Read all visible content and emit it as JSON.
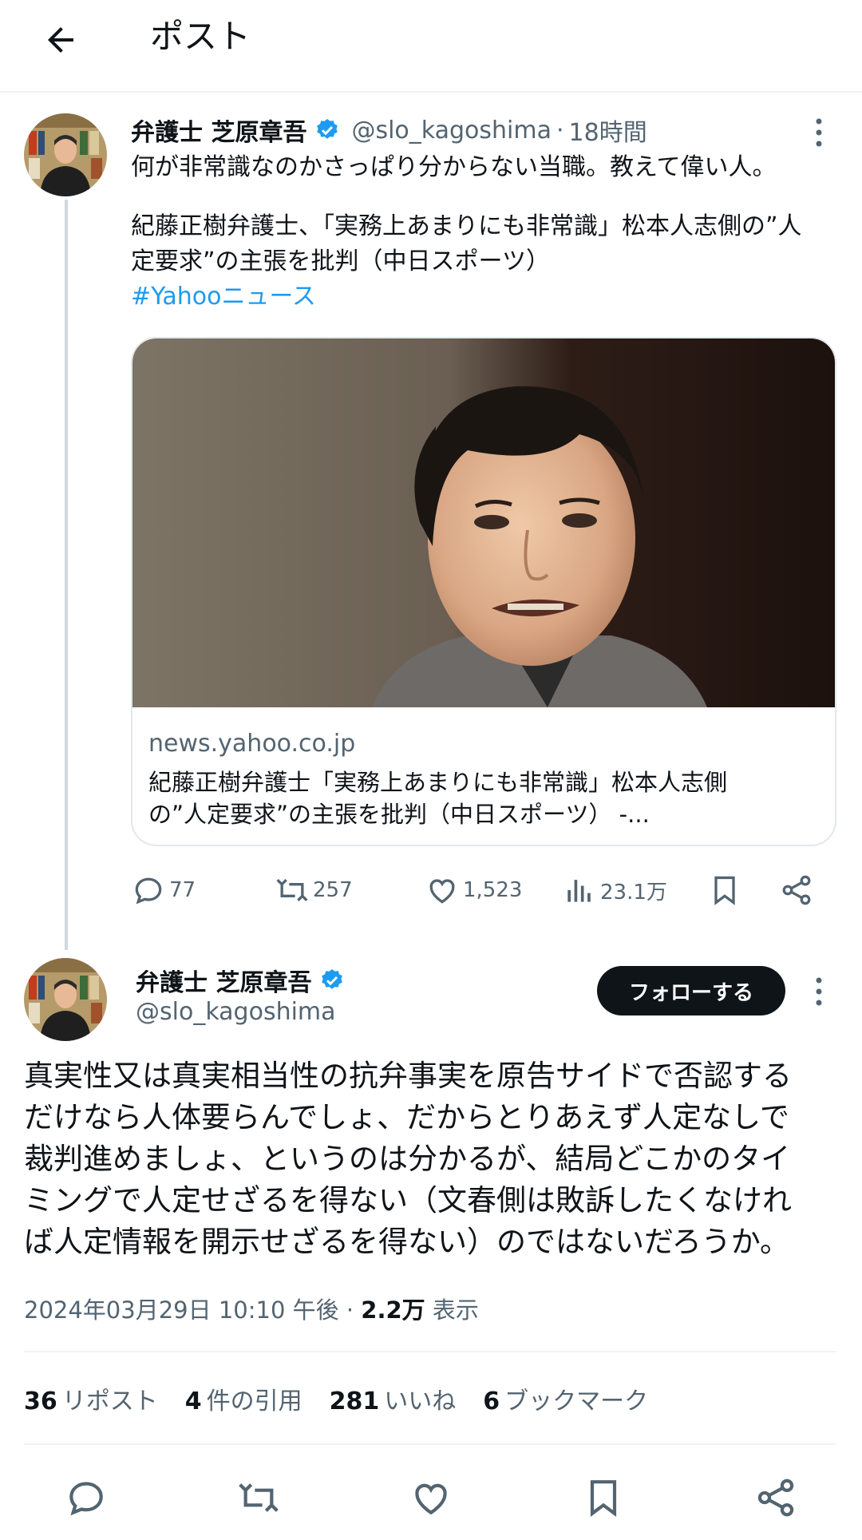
{
  "header": {
    "title": "ポスト"
  },
  "post1": {
    "author_name": "弁護士 芝原章吾",
    "handle": "@slo_kagoshima",
    "separator": "·",
    "time": "18時間",
    "text_line1": "何が非常識なのかさっぱり分からない当職。教えて偉い人。",
    "text_line2": "紀藤正樹弁護士、「実務上あまりにも非常識」松本人志側の”人",
    "text_line3": "定要求”の主張を批判（中日スポーツ）",
    "hashtag": "#Yahooニュース",
    "card": {
      "domain": "news.yahoo.co.jp",
      "title_line1": "紀藤正樹弁護士「実務上あまりにも非常識」松本人志側",
      "title_line2": "の”人定要求”の主張を批判（中日スポーツ） -..."
    },
    "actions": {
      "replies": "77",
      "reposts": "257",
      "likes": "1,523",
      "views": "23.1万"
    }
  },
  "post2": {
    "author_name": "弁護士 芝原章吾",
    "handle": "@slo_kagoshima",
    "follow_label": "フォローする",
    "text_lines": [
      "真実性又は真実相当性の抗弁事実を原告サイドで否認する",
      "だけなら人体要らんでしょ、だからとりあえず人定なしで",
      "裁判進めましょ、というのは分かるが、結局どこかのタイ",
      "ミングで人定せざるを得ない（文春側は敗訴したくなけれ",
      "ば人定情報を開示せざるを得ない）のではないだろうか。"
    ],
    "timestamp": "2024年03月29日 10:10 午後",
    "meta_sep": "·",
    "views_count": "2.2万",
    "views_label": "表示",
    "stats": {
      "reposts_count": "36",
      "reposts_label": "リポスト",
      "quotes_count": "4",
      "quotes_label": "件の引用",
      "likes_count": "281",
      "likes_label": "いいね",
      "bookmarks_count": "6",
      "bookmarks_label": "ブックマーク"
    }
  },
  "colors": {
    "accent": "#1d9bf0",
    "text": "#0f1419",
    "secondary": "#536471",
    "border": "#eff3f4"
  }
}
